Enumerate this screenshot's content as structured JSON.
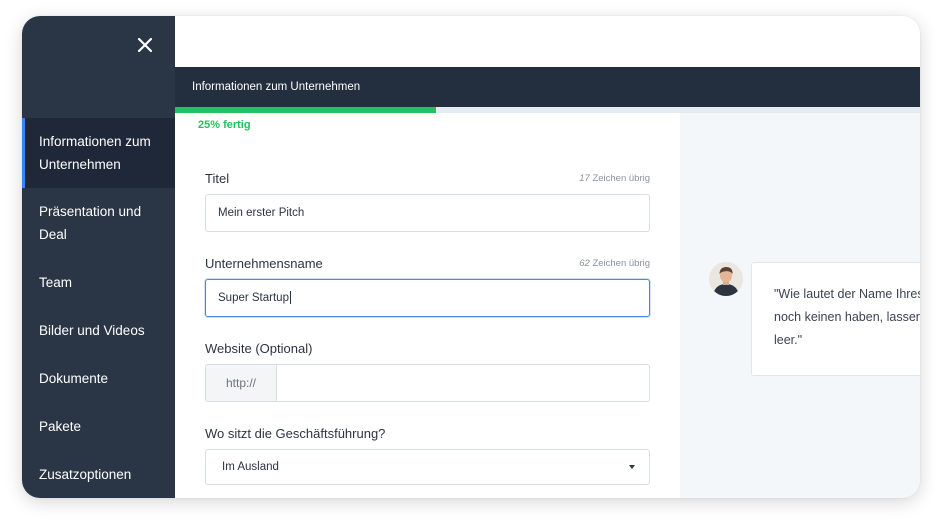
{
  "sidebar": {
    "items": [
      {
        "label": "Informationen zum Unternehmen",
        "active": true
      },
      {
        "label": "Präsentation und Deal",
        "active": false
      },
      {
        "label": "Team",
        "active": false
      },
      {
        "label": "Bilder und Videos",
        "active": false
      },
      {
        "label": "Dokumente",
        "active": false
      },
      {
        "label": "Pakete",
        "active": false
      },
      {
        "label": "Zusatzoptionen",
        "active": false
      }
    ]
  },
  "header": {
    "step_title": "Informationen zum Unternehmen"
  },
  "progress": {
    "label": "25% fertig",
    "fraction": 0.35,
    "color": "#22c35e"
  },
  "form": {
    "title": {
      "label": "Titel",
      "count": "17",
      "count_suffix": "Zeichen übrig",
      "value": "Mein erster Pitch"
    },
    "company": {
      "label": "Unternehmensname",
      "count": "62",
      "count_suffix": "Zeichen übrig",
      "value": "Super Startup"
    },
    "website": {
      "label": "Website (Optional)",
      "prefix": "http://",
      "value": ""
    },
    "hq": {
      "label": "Wo sitzt die Geschäftsführung?",
      "selected": "Im Ausland"
    }
  },
  "hint": {
    "lines": [
      "\"Wie lautet der Name Ihres",
      "noch keinen haben, lassen",
      "leer.\""
    ]
  },
  "colors": {
    "sidebar_bg": "#2a3546",
    "active_accent": "#3b82f6",
    "focus_border": "#4a88e0"
  }
}
